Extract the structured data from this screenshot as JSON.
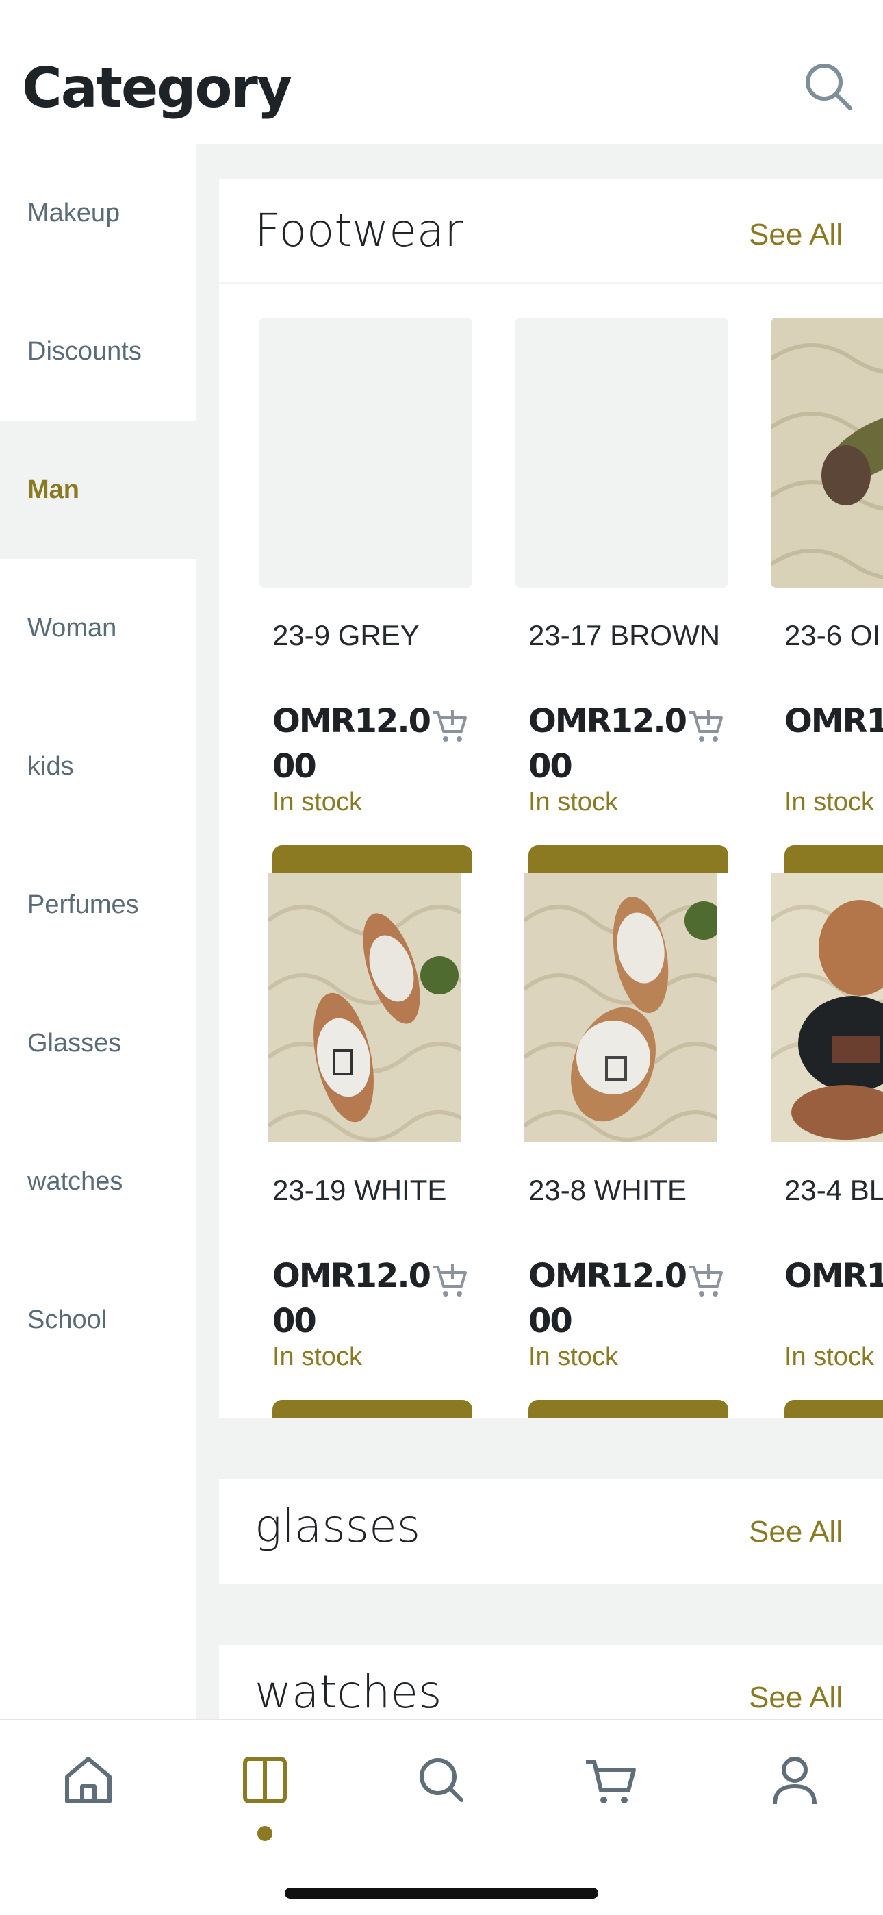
{
  "header": {
    "title": "Category"
  },
  "sidebar": {
    "items": [
      {
        "label": "Makeup",
        "active": false
      },
      {
        "label": "Discounts",
        "active": false
      },
      {
        "label": "Man",
        "active": true
      },
      {
        "label": "Woman",
        "active": false
      },
      {
        "label": "kids",
        "active": false
      },
      {
        "label": "Perfumes",
        "active": false
      },
      {
        "label": "Glasses",
        "active": false
      },
      {
        "label": "watches",
        "active": false
      },
      {
        "label": "School",
        "active": false
      }
    ]
  },
  "sections": {
    "footwear": {
      "title": "Footwear",
      "see_all": "See All",
      "products": [
        {
          "name": "23-9 GREY",
          "price": "OMR12.000",
          "stock": "In stock",
          "image": "placeholder"
        },
        {
          "name": "23-17 BROWN",
          "price": "OMR12.000",
          "stock": "In stock",
          "image": "placeholder"
        },
        {
          "name": "23-6 OI",
          "price": "OMR1",
          "stock": "In stock",
          "image": "olive-sandal"
        },
        {
          "name": "23-19 WHITE",
          "price": "OMR12.000",
          "stock": "In stock",
          "image": "white-sandal"
        },
        {
          "name": "23-8 WHITE",
          "price": "OMR12.000",
          "stock": "In stock",
          "image": "white-sandal"
        },
        {
          "name": "23-4 BL",
          "price": "OMR1",
          "stock": "In stock",
          "image": "black-sandal"
        }
      ]
    },
    "glasses": {
      "title": "glasses",
      "see_all": "See All"
    },
    "watches": {
      "title": "watches",
      "see_all": "See All"
    }
  },
  "tabbar": {
    "tabs": [
      {
        "icon": "home-icon"
      },
      {
        "icon": "category-icon",
        "active": true
      },
      {
        "icon": "search-icon"
      },
      {
        "icon": "cart-icon"
      },
      {
        "icon": "profile-icon"
      }
    ]
  },
  "colors": {
    "accent": "#8b7a22",
    "text": "#1f2328",
    "muted": "#5a6b78",
    "surface": "#f1f2f2"
  }
}
